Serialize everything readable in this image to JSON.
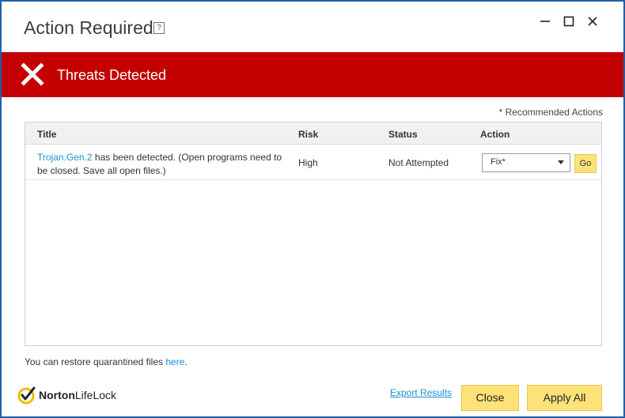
{
  "window": {
    "title": "Action Required",
    "help_label": "?"
  },
  "controls": {
    "minimize": "—",
    "maximize": "☐",
    "close": "✕"
  },
  "banner": {
    "text": "Threats Detected",
    "color": "#c40000"
  },
  "recommended_note": "* Recommended Actions",
  "table": {
    "headers": {
      "title": "Title",
      "risk": "Risk",
      "status": "Status",
      "action": "Action"
    },
    "rows": [
      {
        "threat_name": "Trojan.Gen.2",
        "description": " has been detected. (Open programs need to be closed. Save all open files.)",
        "risk": "High",
        "status": "Not Attempted",
        "action_selected": "Fix*",
        "go_label": "Go"
      }
    ]
  },
  "restore": {
    "prefix": "You can restore quarantined files ",
    "link": "here",
    "suffix": "."
  },
  "footer": {
    "logo_bold": "Norton",
    "logo_rest": "LifeLock",
    "export_label": "Export Results",
    "close_label": "Close",
    "apply_label": "Apply All"
  },
  "colors": {
    "accent_yellow": "#fde27a",
    "link_blue": "#1a8fd6",
    "border_blue": "#1f5fa8"
  }
}
